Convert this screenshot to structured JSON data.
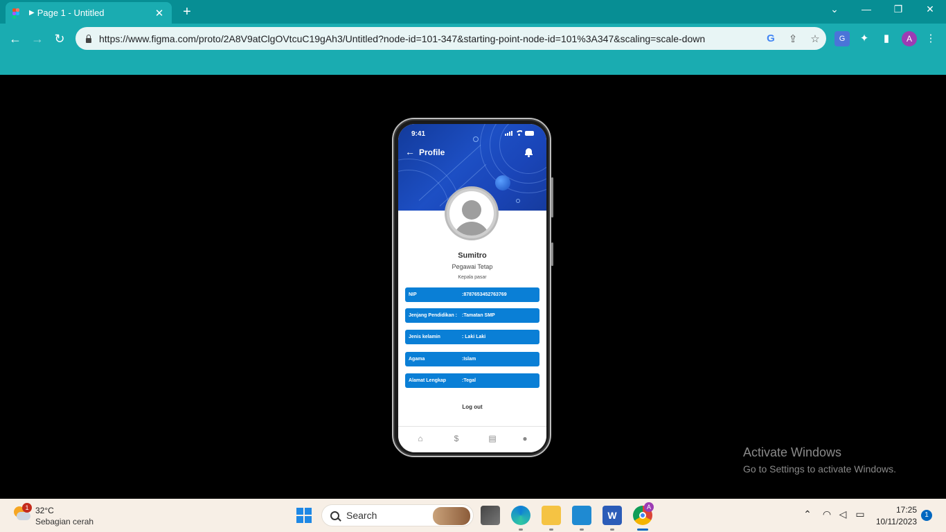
{
  "browser": {
    "tab_title": "Page 1 - Untitled",
    "url": "https://www.figma.com/proto/2A8V9atClgOVtcuC19gAh3/Untitled?node-id=101-347&starting-point-node-id=101%3A347&scaling=scale-down",
    "profile_initial": "A",
    "accent": "#1aacb1"
  },
  "phone": {
    "status_time": "9:41",
    "header_title": "Profile",
    "name": "Sumitro",
    "employment_status": "Pegawai Tetap",
    "position": "Kepala pasar",
    "fields": [
      {
        "label": "NIP",
        "value": ":8787653452763769"
      },
      {
        "label": "Jenjang Pendidikan :",
        "value": ":Tamatan SMP"
      },
      {
        "label": "Jenis kelamin",
        "value": ": Laki Laki"
      },
      {
        "label": "Agama",
        "value": ":Islam"
      },
      {
        "label": "Alamat Lengkap",
        "value": ":Tegal"
      }
    ],
    "logout_label": "Log out",
    "field_color": "#0a7fd6",
    "bottom_nav": [
      "home-icon",
      "money-bag-icon",
      "clipboard-icon",
      "user-icon"
    ]
  },
  "watermark": {
    "line1": "Activate Windows",
    "line2": "Go to Settings to activate Windows."
  },
  "taskbar": {
    "weather_badge": "1",
    "temperature": "32°C",
    "condition": "Sebagian cerah",
    "search_label": "Search",
    "chrome_badge": "A",
    "time": "17:25",
    "date": "10/11/2023",
    "notification_count": "1"
  }
}
